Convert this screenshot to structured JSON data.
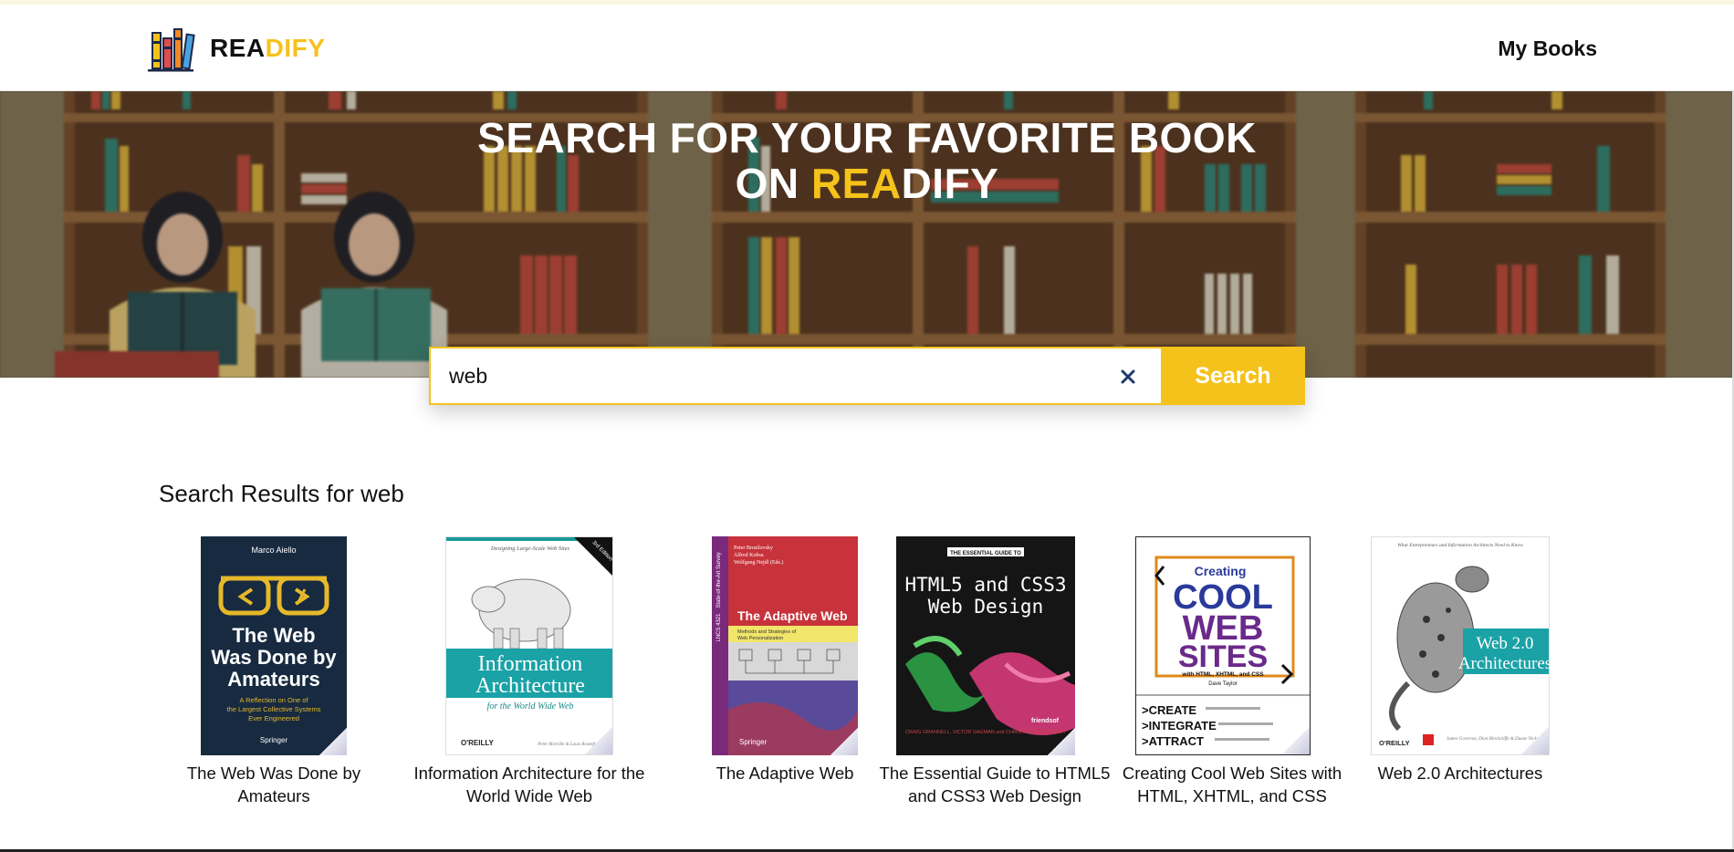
{
  "brand": {
    "part1": "REA",
    "part2": "DIFY"
  },
  "nav": {
    "my_books": "My Books"
  },
  "hero": {
    "line1": "SEARCH FOR YOUR FAVORITE BOOK",
    "line2_prefix": "ON ",
    "line2_hl": "REA",
    "line2_suffix": "DIFY"
  },
  "search": {
    "value": "web",
    "button_label": "Search",
    "clear_icon": "close-icon"
  },
  "results": {
    "heading": "Search Results for web",
    "books": [
      {
        "title": "The Web Was Done by Amateurs",
        "cover": {
          "bg": "#172a40",
          "author": "Marco Aiello",
          "main": "The Web Was Done by Amateurs",
          "sub": "A Reflection on One of the Largest Collective Systems Ever Engineered",
          "publisher": "Springer"
        }
      },
      {
        "title": "Information Architecture for the World Wide Web",
        "cover": {
          "bg": "#ffffff",
          "tagline": "Designing Large-Scale Web Sites",
          "edition": "3rd Edition",
          "main1": "Information",
          "main2": "Architecture",
          "sub": "for the World Wide Web",
          "publisher": "O'REILLY",
          "authors": "Peter Morville & Louis Rosenfeld"
        }
      },
      {
        "title": "The Adaptive Web",
        "cover": {
          "bg": "#c8323a",
          "authors": "Peter Brusilovsky Alfred Kobsa Wolfgang Nejdl (Eds.)",
          "series": "State-of-the-Art Survey",
          "lncs": "LNCS 4321",
          "main": "The Adaptive Web",
          "sub": "Methods and Strategies of Web Personalization",
          "publisher": "Springer"
        }
      },
      {
        "title": "The Essential Guide to HTML5 and CSS3 Web Design",
        "cover": {
          "bg": "#151515",
          "banner": "THE ESSENTIAL GUIDE TO",
          "main1": "HTML5 and CSS3",
          "main2": "Web Design",
          "authors": "CRAIG GRANNELL, VICTOR SAGMAN and CHRISTOPHER SCHMITT",
          "publisher": "friendsof"
        }
      },
      {
        "title": "Creating Cool Web Sites with HTML, XHTML, and CSS",
        "cover": {
          "bg": "#ffffff",
          "top": "Creating",
          "main1": "COOL",
          "main2": "WEB",
          "main3": "SITES",
          "sub": "with HTML, XHTML, and CSS",
          "author": "Dave Taylor",
          "b1": ">CREATE",
          "b2": ">INTEGRATE",
          "b3": ">ATTRACT"
        }
      },
      {
        "title": "Web 2.0 Architectures",
        "cover": {
          "bg": "#ffffff",
          "tagline": "What Entrepreneurs and Information Architects Need to Know",
          "main1": "Web 2.0",
          "main2": "Architectures",
          "publisher": "O'REILLY",
          "authors": "James Governor, Dion Hinchcliffe & Duane Nickull"
        }
      }
    ]
  },
  "colors": {
    "accent": "#f5c21b",
    "text": "#111111",
    "nav_bg": "#ffffff"
  }
}
